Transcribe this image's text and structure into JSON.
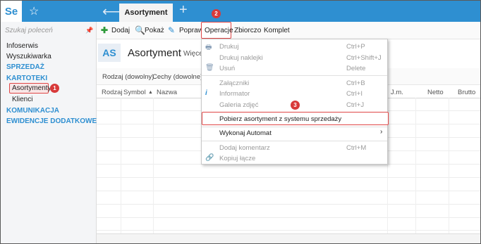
{
  "app": {
    "logo_text": "Se",
    "active_tab": "Asortyment"
  },
  "sidebar": {
    "search_placeholder": "Szukaj poleceń",
    "items": [
      {
        "label": "Infoserwis",
        "type": "item"
      },
      {
        "label": "Wyszukiwarka",
        "type": "item"
      },
      {
        "label": "SPRZEDAŻ",
        "type": "section"
      },
      {
        "label": "KARTOTEKI",
        "type": "section"
      },
      {
        "label": "Asortymenty",
        "type": "sub"
      },
      {
        "label": "Klienci",
        "type": "sub"
      },
      {
        "label": "KOMUNIKACJA",
        "type": "section"
      },
      {
        "label": "EWIDENCJE DODATKOWE",
        "type": "section"
      }
    ]
  },
  "toolbar": {
    "add": "Dodaj",
    "show": "Pokaż",
    "edit": "Popraw",
    "operations": "Operacje",
    "bulk": "Zbiorczo",
    "set": "Komplet"
  },
  "header": {
    "badge": "AS",
    "title": "Asortyment",
    "more": "Więcej"
  },
  "filters": {
    "kind": "Rodzaj (dowolny)",
    "features": "Cechy (dowolne)"
  },
  "table": {
    "columns": [
      "Rodzaj",
      "Symbol",
      "Nazwa",
      "J.m.",
      "Netto",
      "Brutto"
    ]
  },
  "menu": {
    "print": {
      "label": "Drukuj",
      "shortcut": "Ctrl+P"
    },
    "print_labels": {
      "label": "Drukuj naklejki",
      "shortcut": "Ctrl+Shift+J"
    },
    "delete": {
      "label": "Usuń",
      "shortcut": "Delete"
    },
    "attachments": {
      "label": "Załączniki",
      "shortcut": "Ctrl+B"
    },
    "informer": {
      "label": "Informator",
      "shortcut": "Ctrl+I"
    },
    "gallery": {
      "label": "Galeria zdjęć",
      "shortcut": "Ctrl+J"
    },
    "fetch": {
      "label": "Pobierz asortyment z systemu sprzedaży"
    },
    "automat": {
      "label": "Wykonaj Automat"
    },
    "comment": {
      "label": "Dodaj komentarz",
      "shortcut": "Ctrl+M"
    },
    "copy_link": {
      "label": "Kopiuj łącze"
    }
  },
  "badges": {
    "one": "1",
    "two": "2",
    "three": "3"
  },
  "colors": {
    "accent": "#2e8fd1",
    "highlight": "#e04646"
  }
}
